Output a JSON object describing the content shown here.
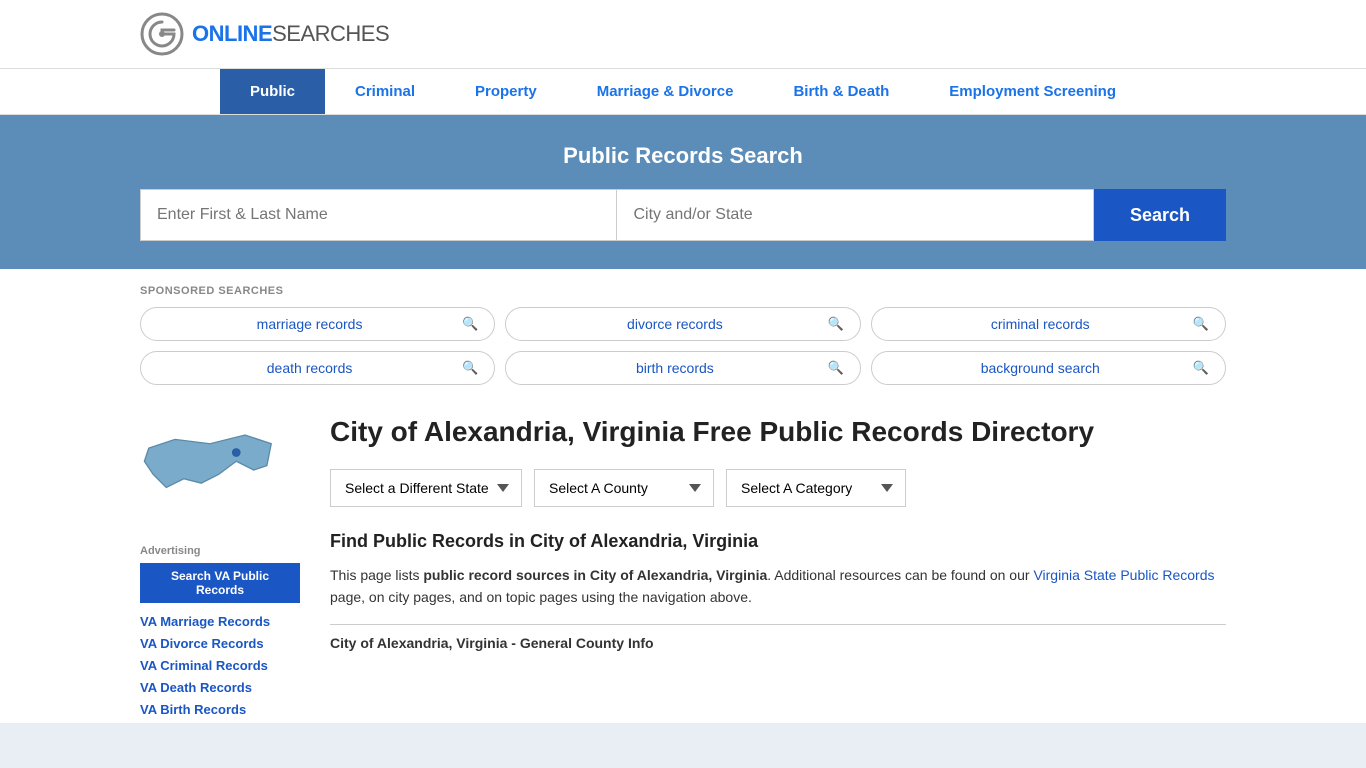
{
  "site": {
    "logo_online": "ONLINE",
    "logo_searches": "SEARCHES"
  },
  "nav": {
    "items": [
      {
        "label": "Public",
        "active": true
      },
      {
        "label": "Criminal",
        "active": false
      },
      {
        "label": "Property",
        "active": false
      },
      {
        "label": "Marriage & Divorce",
        "active": false
      },
      {
        "label": "Birth & Death",
        "active": false
      },
      {
        "label": "Employment Screening",
        "active": false
      }
    ]
  },
  "search_banner": {
    "title": "Public Records Search",
    "name_placeholder": "Enter First & Last Name",
    "city_placeholder": "City and/or State",
    "button_label": "Search"
  },
  "sponsored": {
    "label": "SPONSORED SEARCHES",
    "items": [
      "marriage records",
      "divorce records",
      "criminal records",
      "death records",
      "birth records",
      "background search"
    ]
  },
  "page": {
    "title": "City of Alexandria, Virginia Free Public Records Directory",
    "dropdowns": {
      "state_label": "Select a Different State",
      "county_label": "Select A County",
      "category_label": "Select A Category"
    },
    "find_title": "Find Public Records in City of Alexandria, Virginia",
    "find_text_1": "This page lists ",
    "find_text_bold": "public record sources in City of Alexandria, Virginia",
    "find_text_2": ". Additional resources can be found on our ",
    "find_link_text": "Virginia State Public Records",
    "find_text_3": " page, on city pages, and on topic pages using the navigation above.",
    "general_info_label": "City of Alexandria, Virginia - General County Info"
  },
  "sidebar": {
    "advertising_label": "Advertising",
    "ad_button_label": "Search VA Public Records",
    "links": [
      "VA Marriage Records",
      "VA Divorce Records",
      "VA Criminal Records",
      "VA Death Records",
      "VA Birth Records"
    ]
  }
}
